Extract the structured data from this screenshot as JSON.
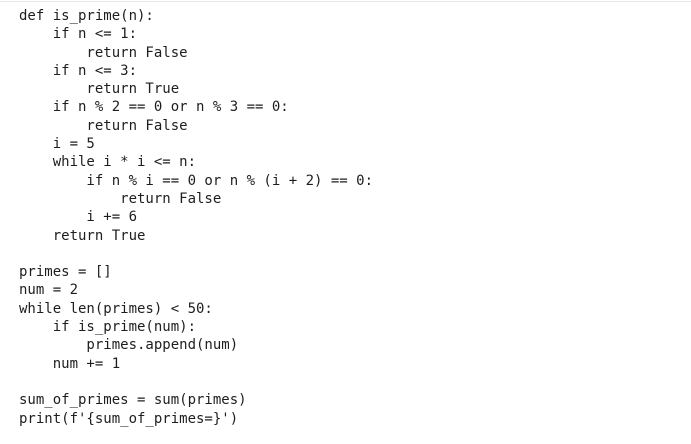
{
  "code": {
    "language": "python",
    "lines": [
      "def is_prime(n):",
      "    if n <= 1:",
      "        return False",
      "    if n <= 3:",
      "        return True",
      "    if n % 2 == 0 or n % 3 == 0:",
      "        return False",
      "    i = 5",
      "    while i * i <= n:",
      "        if n % i == 0 or n % (i + 2) == 0:",
      "            return False",
      "        i += 6",
      "    return True",
      "",
      "primes = []",
      "num = 2",
      "while len(primes) < 50:",
      "    if is_prime(num):",
      "        primes.append(num)",
      "    num += 1",
      "",
      "sum_of_primes = sum(primes)",
      "print(f'{sum_of_primes=}')"
    ]
  }
}
